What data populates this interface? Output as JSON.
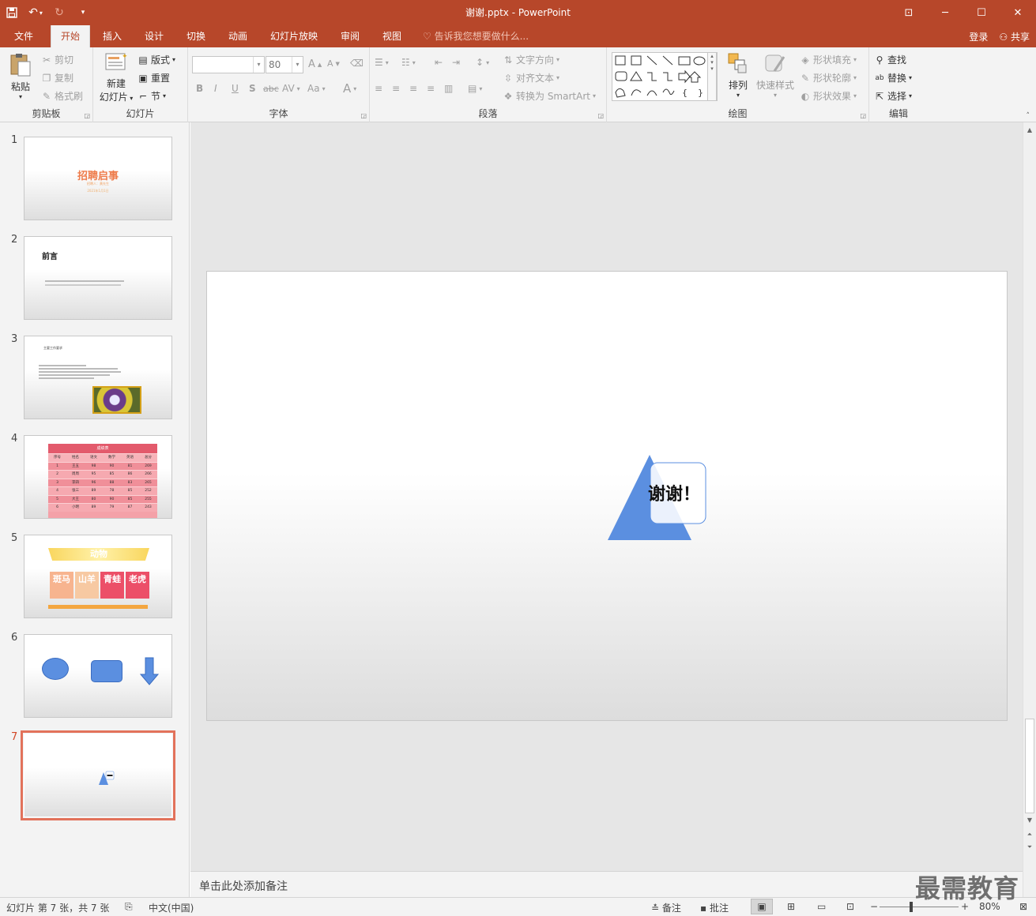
{
  "window": {
    "title": "谢谢.pptx - PowerPoint",
    "controls": [
      "ribbon-display",
      "minimize",
      "maximize",
      "close"
    ]
  },
  "tabs": [
    {
      "label": "文件",
      "active": false
    },
    {
      "label": "开始",
      "active": true
    },
    {
      "label": "插入",
      "active": false
    },
    {
      "label": "设计",
      "active": false
    },
    {
      "label": "切换",
      "active": false
    },
    {
      "label": "动画",
      "active": false
    },
    {
      "label": "幻灯片放映",
      "active": false
    },
    {
      "label": "审阅",
      "active": false
    },
    {
      "label": "视图",
      "active": false
    }
  ],
  "tellme": "告诉我您想要做什么...",
  "account": {
    "signin": "登录",
    "share": "共享"
  },
  "ribbon": {
    "clipboard": {
      "label": "剪贴板",
      "paste": "粘贴",
      "cut": "剪切",
      "copy": "复制",
      "format_painter": "格式刷"
    },
    "slides": {
      "label": "幻灯片",
      "new_slide_1": "新建",
      "new_slide_2": "幻灯片",
      "layout": "版式",
      "reset": "重置",
      "section": "节"
    },
    "font": {
      "label": "字体",
      "font_name": "",
      "font_size": "80",
      "bold": "B",
      "italic": "I",
      "underline": "U",
      "shadow": "S",
      "strike": "abc",
      "spacing": "AV",
      "case": "Aa",
      "color": "A"
    },
    "paragraph": {
      "label": "段落",
      "text_direction": "文字方向",
      "align_text": "对齐文本",
      "smartart": "转换为 SmartArt"
    },
    "drawing": {
      "label": "绘图",
      "arrange": "排列",
      "quick_styles": "快速样式",
      "shape_fill": "形状填充",
      "shape_outline": "形状轮廓",
      "shape_effects": "形状效果"
    },
    "editing": {
      "label": "编辑",
      "find": "查找",
      "replace": "替换",
      "select": "选择"
    }
  },
  "thumbnails": [
    {
      "num": "1",
      "title": "招聘启事",
      "sub1": "招聘人：黄先生",
      "sub2": "2021年1月1日"
    },
    {
      "num": "2",
      "title": "前言"
    },
    {
      "num": "3",
      "title": "主要工作要求"
    },
    {
      "num": "4",
      "title": "成绩表",
      "headers": [
        "序号",
        "姓名",
        "语文",
        "数学",
        "英语",
        "总分"
      ],
      "rows": [
        [
          "1",
          "王五",
          "98",
          "90",
          "81",
          "269"
        ],
        [
          "2",
          "周周",
          "95",
          "85",
          "86",
          "266"
        ],
        [
          "3",
          "李四",
          "96",
          "88",
          "83",
          "265"
        ],
        [
          "4",
          "张三",
          "89",
          "78",
          "85",
          "252"
        ],
        [
          "5",
          "大王",
          "80",
          "90",
          "85",
          "255"
        ],
        [
          "6",
          "小明",
          "89",
          "79",
          "87",
          "243"
        ]
      ]
    },
    {
      "num": "5",
      "title": "动物",
      "boxes": [
        "斑马",
        "山羊",
        "青蛙",
        "老虎"
      ]
    },
    {
      "num": "6"
    },
    {
      "num": "7",
      "selected": true
    }
  ],
  "slide": {
    "text": "谢谢！"
  },
  "notes": {
    "placeholder": "单击此处添加备注"
  },
  "status": {
    "slide_info": "幻灯片 第 7 张，共 7 张",
    "language": "中文(中国)",
    "notes": "备注",
    "comments": "批注",
    "zoom": "80%"
  },
  "watermark": "最需教育",
  "colors": {
    "accent": "#b7472a",
    "shape_blue": "#5b8fe0",
    "selection": "#e2725b"
  }
}
